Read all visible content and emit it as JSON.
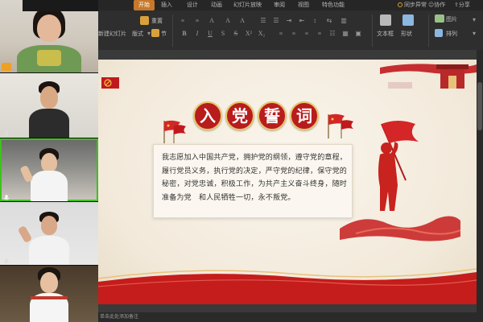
{
  "ribbon": {
    "tabs": [
      "开始",
      "插入",
      "设计",
      "动画",
      "幻灯片放映",
      "审阅",
      "视图",
      "特色功能"
    ],
    "active_tab": "开始",
    "right": {
      "sync": "同步异常",
      "collab": "协作",
      "share": "分享"
    },
    "buttons": {
      "reset": "重置",
      "new_slide": "新建幻灯片",
      "layout": "版式",
      "section": "节",
      "textbox": "文本框",
      "shape": "形状",
      "picture": "图片",
      "arrange": "排列"
    }
  },
  "slide": {
    "title_chars": [
      "入",
      "党",
      "誓",
      "词"
    ],
    "oath_lines": [
      "我志愿加入中国共产党，拥护党的纲领，遵守党的章程，",
      "履行党员义务，执行党的决定，严守党的纪律，保守党的",
      "秘密，对党忠诚，积极工作，为共产主义奋斗终身，随时",
      "准备为党　和人民牺牲一切，永不叛党。"
    ]
  },
  "statusbar": {
    "notes": "单击此处添加备注"
  },
  "colors": {
    "accent": "#b81c1c",
    "active_tab": "#c8782a",
    "active_speaker": "#3cc21b"
  },
  "participants": [
    {
      "tile": "participant-tile-1"
    },
    {
      "tile": "participant-tile-2"
    },
    {
      "tile": "participant-tile-3",
      "active": true
    },
    {
      "tile": "participant-tile-4"
    },
    {
      "tile": "participant-tile-5"
    }
  ]
}
